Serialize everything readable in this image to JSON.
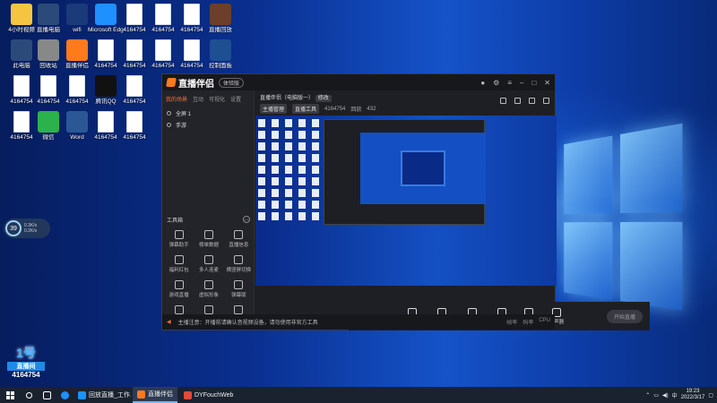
{
  "desktop": {
    "icons": [
      {
        "label": "4小时视频",
        "kind": "folder",
        "color": "#f5c542"
      },
      {
        "label": "直播电脑",
        "kind": "app",
        "color": "#2b4a7a"
      },
      {
        "label": "wifi",
        "kind": "app",
        "color": "#1a3a7a"
      },
      {
        "label": "Microsoft Edge",
        "kind": "app",
        "color": "#1e90ff"
      },
      {
        "label": "4164754",
        "kind": "file"
      },
      {
        "label": "4164754",
        "kind": "file"
      },
      {
        "label": "4164754",
        "kind": "file"
      },
      {
        "label": "直播回放",
        "kind": "app",
        "color": "#6b3f2a"
      },
      {
        "label": "此电脑",
        "kind": "app",
        "color": "#2b4a7a"
      },
      {
        "label": "回收站",
        "kind": "app",
        "color": "#888"
      },
      {
        "label": "直播伴侣",
        "kind": "app",
        "color": "#ff7a1a"
      },
      {
        "label": "4164754",
        "kind": "file"
      },
      {
        "label": "4164754",
        "kind": "file"
      },
      {
        "label": "4164754",
        "kind": "file"
      },
      {
        "label": "4164754",
        "kind": "file"
      },
      {
        "label": "控制面板",
        "kind": "app",
        "color": "#1d4f91"
      },
      {
        "label": "4164754",
        "kind": "file"
      },
      {
        "label": "4164754",
        "kind": "file"
      },
      {
        "label": "4164754",
        "kind": "file"
      },
      {
        "label": "腾讯QQ",
        "kind": "app",
        "color": "#111"
      },
      {
        "label": "4164754",
        "kind": "file"
      },
      {
        "label": "4164754",
        "kind": "file"
      },
      {
        "label": "Internet Explorer",
        "kind": "app",
        "color": "#1e90ff"
      },
      {
        "label": "腾讯电脑管家",
        "kind": "app",
        "color": "#1d8ae8"
      },
      {
        "label": "4164754",
        "kind": "file"
      },
      {
        "label": "微信",
        "kind": "app",
        "color": "#2bb24c"
      },
      {
        "label": "Word",
        "kind": "app",
        "color": "#2b5797"
      },
      {
        "label": "4164754",
        "kind": "file"
      },
      {
        "label": "4164754",
        "kind": "file"
      },
      {
        "label": "4164754",
        "kind": "file"
      }
    ]
  },
  "speed_widget": {
    "percent": "39",
    "up": "0.3K/s",
    "down": "0.2K/s"
  },
  "brand_badge": {
    "line1": "1号",
    "line2": "直播间",
    "line3": "4164754"
  },
  "app": {
    "title": "直播伴侣",
    "version_pill": "体验版",
    "left_tabs": [
      "我的场景",
      "互动",
      "可视化",
      "设置"
    ],
    "scenes": [
      "全屏 1",
      "手游"
    ],
    "tools_title": "工具箱",
    "tools": [
      {
        "label": "弹幕助手"
      },
      {
        "label": "榜单数据"
      },
      {
        "label": "直播信息"
      },
      {
        "label": "福利红包"
      },
      {
        "label": "多人连麦"
      },
      {
        "label": "横竖屏切换"
      },
      {
        "label": "游戏直播"
      },
      {
        "label": "虚拟形象"
      },
      {
        "label": "弹幕版"
      },
      {
        "label": "抖音"
      },
      {
        "label": "更多"
      },
      {
        "label": ""
      }
    ],
    "stream_title": "直播伴侣（电脑版一）",
    "stream_tag": "修改",
    "stream_meta": [
      "主播管理",
      "直播工具",
      "4164754",
      "回放",
      "432"
    ],
    "bottom_buttons": [
      {
        "label": "直播屏幕"
      },
      {
        "label": "摄像头"
      },
      {
        "label": "手机投屏"
      },
      {
        "label": "多媒体"
      },
      {
        "label": "麦克风"
      },
      {
        "label": "扬声器"
      }
    ],
    "go_live_label": "开始直播",
    "status_warning": "主播注意：开播前请确认音视频设备，请勿使用非官方工具",
    "status_right": [
      "帧率",
      "码率",
      "CPU"
    ]
  },
  "taskbar": {
    "apps": [
      {
        "label": "回放直播_工作...",
        "color": "#1e90ff",
        "active": false
      },
      {
        "label": "直播伴侣",
        "color": "#ff7a1a",
        "active": true
      },
      {
        "label": "DYFouchWeb",
        "color": "#e24a3a",
        "active": false
      }
    ],
    "time": "19:23",
    "date": "2022/3/17"
  }
}
